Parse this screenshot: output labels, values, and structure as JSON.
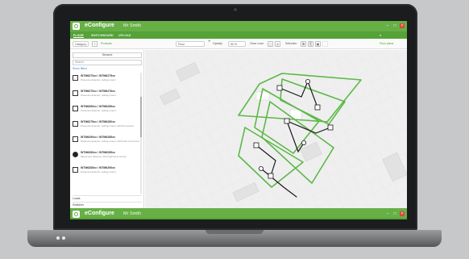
{
  "app": {
    "title": "eConfigure",
    "project": "Mr Smith",
    "window_controls": [
      "–",
      "□",
      "×"
    ]
  },
  "tabs": [
    {
      "label": "FLOOR",
      "active": true
    },
    {
      "label": "SWITCHBOARD",
      "active": false
    },
    {
      "label": "UPLOAD",
      "active": false
    }
  ],
  "toolbar": {
    "categories_label": "Category",
    "products_label": "Products",
    "layer_value": "Floor",
    "opacity_label": "Opacity",
    "opacity_value": "50 %",
    "clear_room_label": "Clear room",
    "selection_label": "Selection",
    "floor_plans_label": "Floor plans"
  },
  "sidebar": {
    "category_select": "Sensors",
    "search_placeholder": "Search",
    "filter_link": "Show filters",
    "products": [
      {
        "name": "WTM6270xx / WTM6275xx",
        "desc": "Presence detector, ceiling-mount",
        "icon": "square"
      },
      {
        "name": "WTM6270xx / WTM6276xx",
        "desc": "Presence detector, ceiling-mount",
        "icon": "square"
      },
      {
        "name": "WTM6280xx / WTM6285xx",
        "desc": "Presence detector, ceiling-mount",
        "icon": "square"
      },
      {
        "name": "WTM6275xx / WTM6280xx",
        "desc": "Presence detector, ceiling-mount, with IR receiver",
        "icon": "square"
      },
      {
        "name": "WTM6290xx / WTM6285xx",
        "desc": "Presence detector, ceiling-mount, with flush-mount box",
        "icon": "square"
      },
      {
        "name": "WTM6280xx / WTM6285xx",
        "desc": "Movement detector, with brightness sensor",
        "icon": "round"
      },
      {
        "name": "WTM6285xx / WTM6290xx",
        "desc": "Presence detector, ceiling-mount",
        "icon": "square"
      }
    ],
    "bottom_sections": [
      "Loads",
      "Switches"
    ]
  },
  "colors": {
    "brand_green": "#66b046",
    "room_outline": "#5cb848",
    "wire": "#1a1a1a"
  }
}
